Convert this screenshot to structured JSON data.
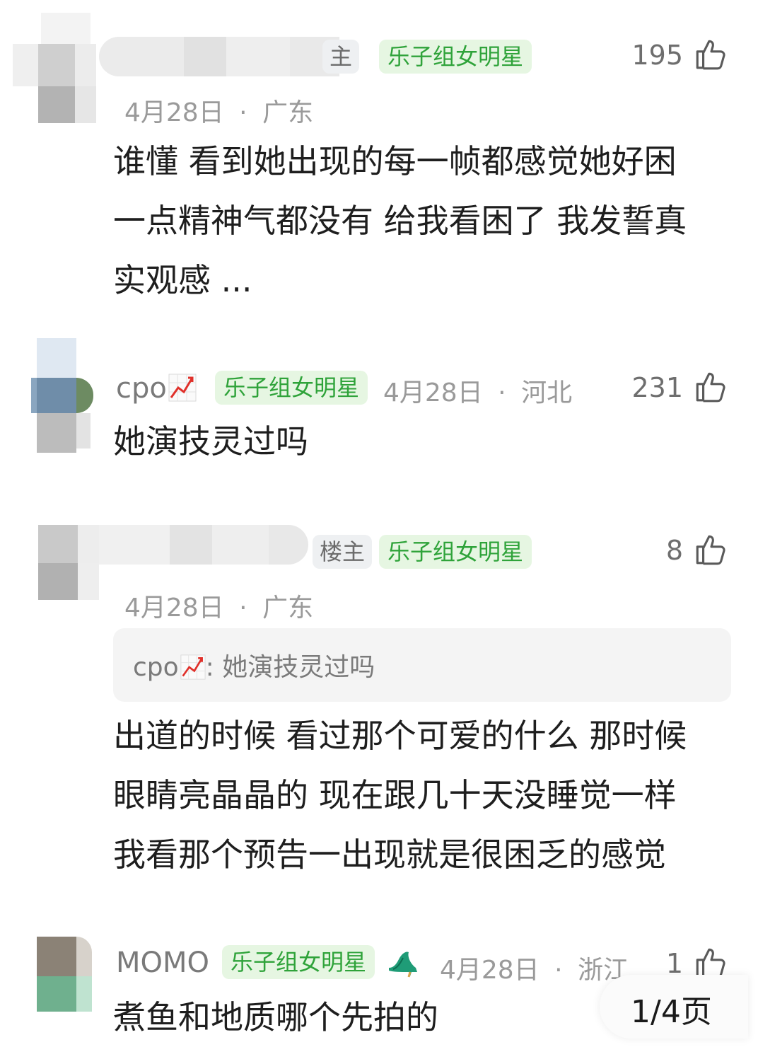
{
  "comments": [
    {
      "owner_tag": "楼主",
      "owner_tag_partial": "主",
      "badge": "乐子组女明星",
      "date": "4月28日",
      "location": "广东",
      "likes": "195",
      "text_lines": [
        "谁懂 看到她出现的每一帧都感觉她好困",
        "一点精神气都没有 给我看困了  我发誓真",
        "实观感 ..."
      ]
    },
    {
      "username": "cpo",
      "badge": "乐子组女明星",
      "date": "4月28日",
      "location": "河北",
      "likes": "231",
      "text_lines": [
        "她演技灵过吗"
      ]
    },
    {
      "owner_tag": "楼主",
      "badge": "乐子组女明星",
      "date": "4月28日",
      "location": "广东",
      "likes": "8",
      "quote": {
        "username": "cpo",
        "text": ": 她演技灵过吗"
      },
      "text_lines": [
        "出道的时候 看过那个可爱的什么 那时候",
        "眼睛亮晶晶的 现在跟几十天没睡觉一样",
        "我看那个预告一出现就是很困乏的感觉"
      ]
    },
    {
      "username": "MOMO",
      "badge": "乐子组女明星",
      "date": "4月28日",
      "location": "浙江",
      "likes": "1",
      "text_lines": [
        "煮鱼和地质哪个先拍的"
      ]
    }
  ],
  "pagination": {
    "label": "1/4页"
  },
  "separator": "·",
  "icons": {
    "like": "thumbs-up-icon",
    "trend": "chart-increasing-icon",
    "shoe": "high-heel-icon"
  },
  "colors": {
    "badge_bg": "#e6f6e2",
    "badge_text": "#2fa33a",
    "meta_text": "#9a9a9a"
  }
}
